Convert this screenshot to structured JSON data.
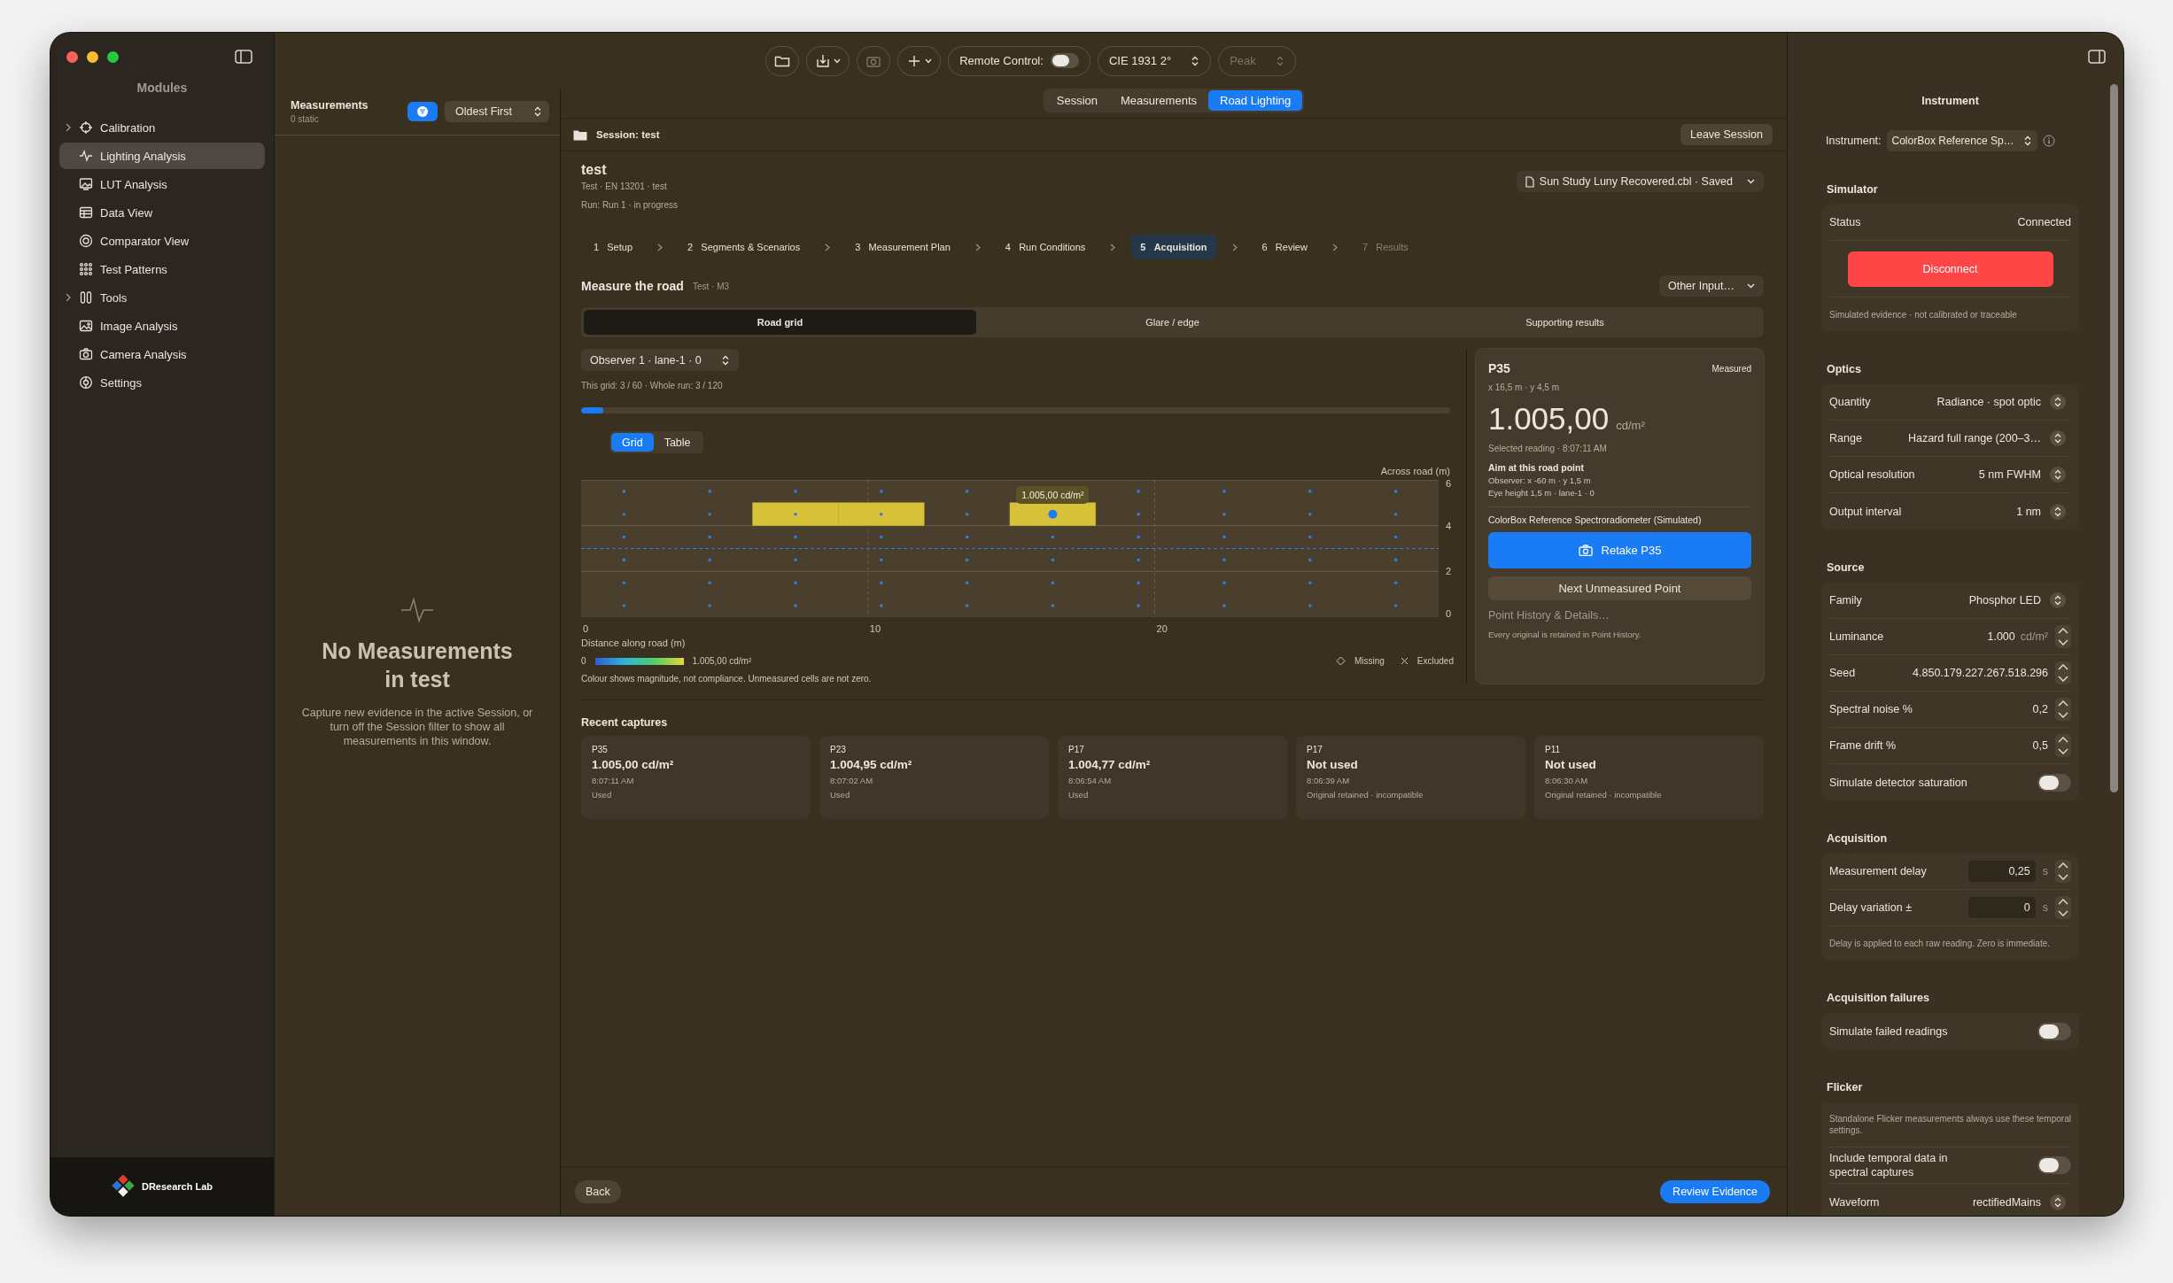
{
  "sidebar": {
    "title": "Modules",
    "items": [
      {
        "label": "Calibration",
        "expandable": true,
        "selected": false
      },
      {
        "label": "Lighting Analysis",
        "expandable": false,
        "selected": true
      },
      {
        "label": "LUT Analysis",
        "expandable": false,
        "selected": false
      },
      {
        "label": "Data View",
        "expandable": false,
        "selected": false
      },
      {
        "label": "Comparator View",
        "expandable": false,
        "selected": false
      },
      {
        "label": "Test Patterns",
        "expandable": false,
        "selected": false
      },
      {
        "label": "Tools",
        "expandable": true,
        "selected": false
      },
      {
        "label": "Image Analysis",
        "expandable": false,
        "selected": false
      },
      {
        "label": "Camera Analysis",
        "expandable": false,
        "selected": false
      },
      {
        "label": "Settings",
        "expandable": false,
        "selected": false
      }
    ],
    "brand": "DResearch Lab"
  },
  "toolbar": {
    "icon_buttons": [
      {
        "disabled": false,
        "menu": false
      },
      {
        "disabled": false,
        "menu": true
      },
      {
        "disabled": true,
        "menu": false
      },
      {
        "disabled": false,
        "menu": true
      }
    ],
    "remote_control": {
      "label": "Remote Control:",
      "on": false
    },
    "observer": "CIE 1931 2°",
    "mode": {
      "label": "Peak",
      "disabled": true
    }
  },
  "measurements": {
    "title": "Measurements",
    "subtitle": "0 static",
    "filter_on": true,
    "sort": "Oldest First",
    "empty_title": "No Measurements in test",
    "empty_text": "Capture new evidence in the active Session, or turn off the Session filter to show all measurements in this window."
  },
  "mode_tabs": [
    {
      "label": "Session",
      "selected": false
    },
    {
      "label": "Measurements",
      "selected": false
    },
    {
      "label": "Road Lighting",
      "selected": true
    }
  ],
  "session_bar": {
    "title": "Session: test",
    "leave": "Leave Session"
  },
  "run": {
    "title": "test",
    "subtitle": "Test · EN 13201 · test",
    "status": "Run: Run 1 · in progress",
    "file": "Sun Study Luny Recovered.cbl · Saved"
  },
  "steps": [
    {
      "number": "1",
      "label": "Setup",
      "selected": false,
      "disabled": false
    },
    {
      "number": "2",
      "label": "Segments & Scenarios",
      "selected": false,
      "disabled": false
    },
    {
      "number": "3",
      "label": "Measurement Plan",
      "selected": false,
      "disabled": false
    },
    {
      "number": "4",
      "label": "Run Conditions",
      "selected": false,
      "disabled": false
    },
    {
      "number": "5",
      "label": "Acquisition",
      "selected": true,
      "disabled": false
    },
    {
      "number": "6",
      "label": "Review",
      "selected": false,
      "disabled": false
    },
    {
      "number": "7",
      "label": "Results",
      "selected": false,
      "disabled": true
    }
  ],
  "section": {
    "title": "Measure the road",
    "subtitle": "Test · M3",
    "menu": "Other Input…"
  },
  "view_tabs": [
    {
      "label": "Road grid",
      "selected": true
    },
    {
      "label": "Glare / edge",
      "selected": false
    },
    {
      "label": "Supporting results",
      "selected": false
    }
  ],
  "observer_picker": "Observer 1 · lane-1 · 0",
  "progress": {
    "text": "This grid: 3 / 60 · Whole run: 3 / 120",
    "level": 0.025
  },
  "view_modes": [
    {
      "label": "Grid",
      "selected": true
    },
    {
      "label": "Table",
      "selected": false
    }
  ],
  "road_grid": {
    "y_axis_label": "Across road (m)",
    "x_axis_label": "Distance along road (m)",
    "x_ticks": [
      "0",
      "10",
      "20"
    ],
    "y_ticks": [
      "6",
      "4",
      "2",
      "0"
    ],
    "tooltip": "1.005,00 cd/m²",
    "rows": [
      {
        "cells": [
          {
            "measured": false,
            "selected": false
          },
          {
            "measured": false,
            "selected": false
          },
          {
            "measured": false,
            "selected": false
          },
          {
            "measured": false,
            "selected": false
          },
          {
            "measured": false,
            "selected": false
          },
          {
            "measured": false,
            "selected": false
          },
          {
            "measured": false,
            "selected": false
          },
          {
            "measured": false,
            "selected": false
          },
          {
            "measured": false,
            "selected": false
          },
          {
            "measured": false,
            "selected": false
          }
        ]
      },
      {
        "cells": [
          {
            "measured": false,
            "selected": false
          },
          {
            "measured": false,
            "selected": false
          },
          {
            "measured": true,
            "selected": false
          },
          {
            "measured": true,
            "selected": false
          },
          {
            "measured": false,
            "selected": false
          },
          {
            "measured": true,
            "selected": true
          },
          {
            "measured": false,
            "selected": false
          },
          {
            "measured": false,
            "selected": false
          },
          {
            "measured": false,
            "selected": false
          },
          {
            "measured": false,
            "selected": false
          }
        ]
      },
      {
        "cells": [
          {
            "measured": false,
            "selected": false
          },
          {
            "measured": false,
            "selected": false
          },
          {
            "measured": false,
            "selected": false
          },
          {
            "measured": false,
            "selected": false
          },
          {
            "measured": false,
            "selected": false
          },
          {
            "measured": false,
            "selected": false
          },
          {
            "measured": false,
            "selected": false
          },
          {
            "measured": false,
            "selected": false
          },
          {
            "measured": false,
            "selected": false
          },
          {
            "measured": false,
            "selected": false
          }
        ]
      },
      {
        "cells": [
          {
            "measured": false,
            "selected": false
          },
          {
            "measured": false,
            "selected": false
          },
          {
            "measured": false,
            "selected": false
          },
          {
            "measured": false,
            "selected": false
          },
          {
            "measured": false,
            "selected": false
          },
          {
            "measured": false,
            "selected": false
          },
          {
            "measured": false,
            "selected": false
          },
          {
            "measured": false,
            "selected": false
          },
          {
            "measured": false,
            "selected": false
          },
          {
            "measured": false,
            "selected": false
          }
        ]
      },
      {
        "cells": [
          {
            "measured": false,
            "selected": false
          },
          {
            "measured": false,
            "selected": false
          },
          {
            "measured": false,
            "selected": false
          },
          {
            "measured": false,
            "selected": false
          },
          {
            "measured": false,
            "selected": false
          },
          {
            "measured": false,
            "selected": false
          },
          {
            "measured": false,
            "selected": false
          },
          {
            "measured": false,
            "selected": false
          },
          {
            "measured": false,
            "selected": false
          },
          {
            "measured": false,
            "selected": false
          }
        ]
      },
      {
        "cells": [
          {
            "measured": false,
            "selected": false
          },
          {
            "measured": false,
            "selected": false
          },
          {
            "measured": false,
            "selected": false
          },
          {
            "measured": false,
            "selected": false
          },
          {
            "measured": false,
            "selected": false
          },
          {
            "measured": false,
            "selected": false
          },
          {
            "measured": false,
            "selected": false
          },
          {
            "measured": false,
            "selected": false
          },
          {
            "measured": false,
            "selected": false
          },
          {
            "measured": false,
            "selected": false
          }
        ]
      }
    ]
  },
  "legend": {
    "min": "0",
    "max": "1.005,00 cd/m²",
    "missing": "Missing",
    "excluded": "Excluded",
    "note": "Colour shows magnitude, not compliance. Unmeasured cells are not zero."
  },
  "point": {
    "id": "P35",
    "state": "Measured",
    "position": "x 16,5 m · y 4,5 m",
    "value": "1.005,00",
    "unit": "cd/m²",
    "reading": "Selected reading · 8:07:11 AM",
    "aim_title": "Aim at this road point",
    "aim_lines": [
      "Observer: x -60 m · y 1,5 m",
      "Eye height 1,5 m · lane-1 · 0"
    ],
    "instrument": "ColorBox Reference Spectroradiometer (Simulated)",
    "retake": "Retake P35",
    "next": "Next Unmeasured Point",
    "history": "Point History & Details…",
    "history_note": "Every original is retained in Point History."
  },
  "captures": {
    "title": "Recent captures",
    "items": [
      {
        "id": "P35",
        "value": "1.005,00 cd/m²",
        "time": "8:07:11 AM",
        "status": "Used"
      },
      {
        "id": "P23",
        "value": "1.004,95 cd/m²",
        "time": "8:07:02 AM",
        "status": "Used"
      },
      {
        "id": "P17",
        "value": "1.004,77 cd/m²",
        "time": "8:06:54 AM",
        "status": "Used"
      },
      {
        "id": "P17",
        "value": "Not used",
        "time": "8:06:39 AM",
        "status": "Original retained · incompatible"
      },
      {
        "id": "P11",
        "value": "Not used",
        "time": "8:06:30 AM",
        "status": "Original retained · incompatible"
      }
    ]
  },
  "footer": {
    "back": "Back",
    "review": "Review Evidence"
  },
  "inspector": {
    "title": "Instrument",
    "instrument_label": "Instrument:",
    "instrument": "ColorBox Reference Sp…",
    "sections": [
      {
        "title": "Simulator",
        "rows": [
          {
            "kind": "status",
            "label": "Status",
            "value": "Connected"
          },
          {
            "kind": "button",
            "label": "Disconnect"
          },
          {
            "kind": "note",
            "text": "Simulated evidence · not calibrated or traceable"
          }
        ]
      },
      {
        "title": "Optics",
        "rows": [
          {
            "kind": "picker",
            "label": "Quantity",
            "value": "Radiance · spot optic"
          },
          {
            "kind": "picker",
            "label": "Range",
            "value": "Hazard full range (200–3…"
          },
          {
            "kind": "picker",
            "label": "Optical resolution",
            "value": "5 nm FWHM"
          },
          {
            "kind": "picker",
            "label": "Output interval",
            "value": "1 nm"
          }
        ]
      },
      {
        "title": "Source",
        "rows": [
          {
            "kind": "picker",
            "label": "Family",
            "value": "Phosphor LED"
          },
          {
            "kind": "stepper",
            "label": "Luminance",
            "value": "1.000",
            "unit": "cd/m²"
          },
          {
            "kind": "stepper",
            "label": "Seed",
            "value": "4.850.179.227.267.518.296"
          },
          {
            "kind": "stepper",
            "label": "Spectral noise %",
            "value": "0,2"
          },
          {
            "kind": "stepper",
            "label": "Frame drift %",
            "value": "0,5"
          },
          {
            "kind": "toggle",
            "label": "Simulate detector saturation",
            "on": false
          }
        ]
      },
      {
        "title": "Acquisition",
        "rows": [
          {
            "kind": "field",
            "label": "Measurement delay",
            "value": "0,25",
            "unit": "s"
          },
          {
            "kind": "field",
            "label": "Delay variation ±",
            "value": "0",
            "unit": "s"
          },
          {
            "kind": "note",
            "text": "Delay is applied to each raw reading. Zero is immediate."
          }
        ]
      },
      {
        "title": "Acquisition failures",
        "rows": [
          {
            "kind": "toggle",
            "label": "Simulate failed readings",
            "on": false
          }
        ]
      },
      {
        "title": "Flicker",
        "rows": [
          {
            "kind": "note",
            "text": "Standalone Flicker measurements always use these temporal settings."
          },
          {
            "kind": "toggle",
            "label": "Include temporal data in spectral captures",
            "on": false
          },
          {
            "kind": "picker",
            "label": "Waveform",
            "value": "rectifiedMains"
          }
        ]
      }
    ]
  }
}
